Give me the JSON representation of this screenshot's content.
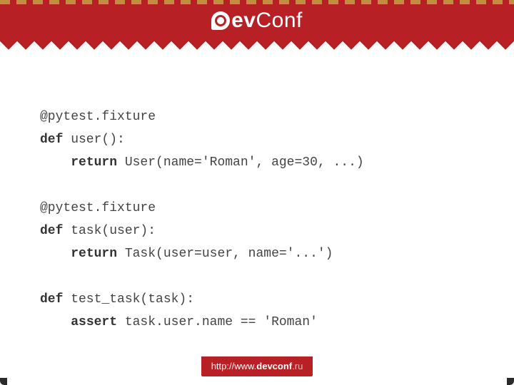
{
  "header": {
    "logo_prefix": "ev",
    "logo_suffix": "Conf"
  },
  "code": {
    "line1": "@pytest.fixture",
    "line2_kw": "def",
    "line2_rest": " user():",
    "line3_indent": "    ",
    "line3_kw": "return",
    "line3_rest": " User(name='Roman', age=30, ...)",
    "line4": "",
    "line5": "@pytest.fixture",
    "line6_kw": "def",
    "line6_rest": " task(user):",
    "line7_indent": "    ",
    "line7_kw": "return",
    "line7_rest": " Task(user=user, name='...')",
    "line8": "",
    "line9_kw": "def",
    "line9_rest": " test_task(task):",
    "line10_indent": "    ",
    "line10_kw": "assert",
    "line10_rest": " task.user.name == 'Roman'"
  },
  "footer": {
    "url_main": "http://www.",
    "url_bold": "devconf",
    "url_tld": ".ru"
  }
}
